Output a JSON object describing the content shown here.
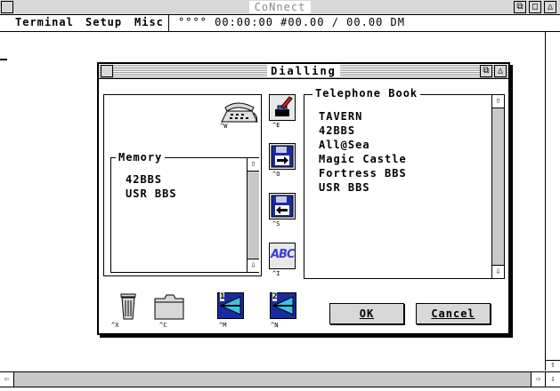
{
  "window": {
    "title": "CoNnect"
  },
  "menubar": {
    "items": [
      "Terminal",
      "Setup",
      "Misc"
    ],
    "status": "°°°° 00:00:00 #00.00 / 00.00 DM"
  },
  "dialog": {
    "title": "Dialling",
    "memory_label": "Memory",
    "memory_items": [
      "42BBS",
      "USR BBS"
    ],
    "phonebook_label": "Telephone Book",
    "phonebook_items": [
      "TAVERN",
      "42BBS",
      "All@Sea",
      "Magic Castle",
      "Fortress BBS",
      "USR BBS"
    ],
    "keys": {
      "phone": "^W",
      "edit": "^E",
      "open": "^O",
      "save": "^S",
      "font": "^I",
      "trash": "^X",
      "clip": "^C",
      "modem1": "^M",
      "modem2": "^N"
    },
    "modem1_num": "1",
    "modem2_num": "2",
    "font_icon_text": "ABC",
    "ok_label": "OK",
    "cancel_label": "Cancel"
  }
}
